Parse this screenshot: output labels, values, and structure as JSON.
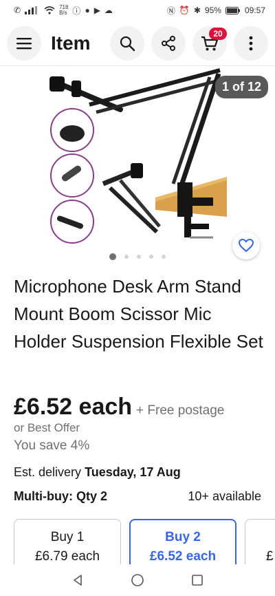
{
  "status_bar": {
    "net_speed_value": "718",
    "net_speed_unit": "B/s",
    "battery": "95%",
    "time": "09:57"
  },
  "header": {
    "title": "Item",
    "cart_count": "20"
  },
  "gallery": {
    "counter": "1 of 12",
    "page_dots": 5,
    "active_dot": 1
  },
  "product": {
    "title": "Microphone Desk Arm Stand Mount Boom Scissor Mic Holder Suspension Flexible Set",
    "price": "£6.52 each",
    "postage": "+ Free postage",
    "best_offer": "or Best Offer",
    "savings": "You save 4%",
    "delivery_label": "Est. delivery",
    "delivery_date": "Tuesday, 17 Aug",
    "multibuy": "Multi-buy: Qty 2",
    "availability": "10+ available"
  },
  "tiers": [
    {
      "label": "Buy 1",
      "price": "£6.79 each",
      "selected": false
    },
    {
      "label": "Buy 2",
      "price": "£6.52 each",
      "selected": true
    },
    {
      "label": "£",
      "price": "",
      "selected": false
    }
  ],
  "colors": {
    "accent": "#3665f3",
    "badge": "#e0103a",
    "text": "#191919",
    "muted": "#707070"
  },
  "icons": [
    "menu-icon",
    "search-icon",
    "share-icon",
    "cart-icon",
    "more-vertical-icon",
    "heart-icon",
    "back-nav-icon",
    "home-nav-icon",
    "recents-nav-icon"
  ]
}
